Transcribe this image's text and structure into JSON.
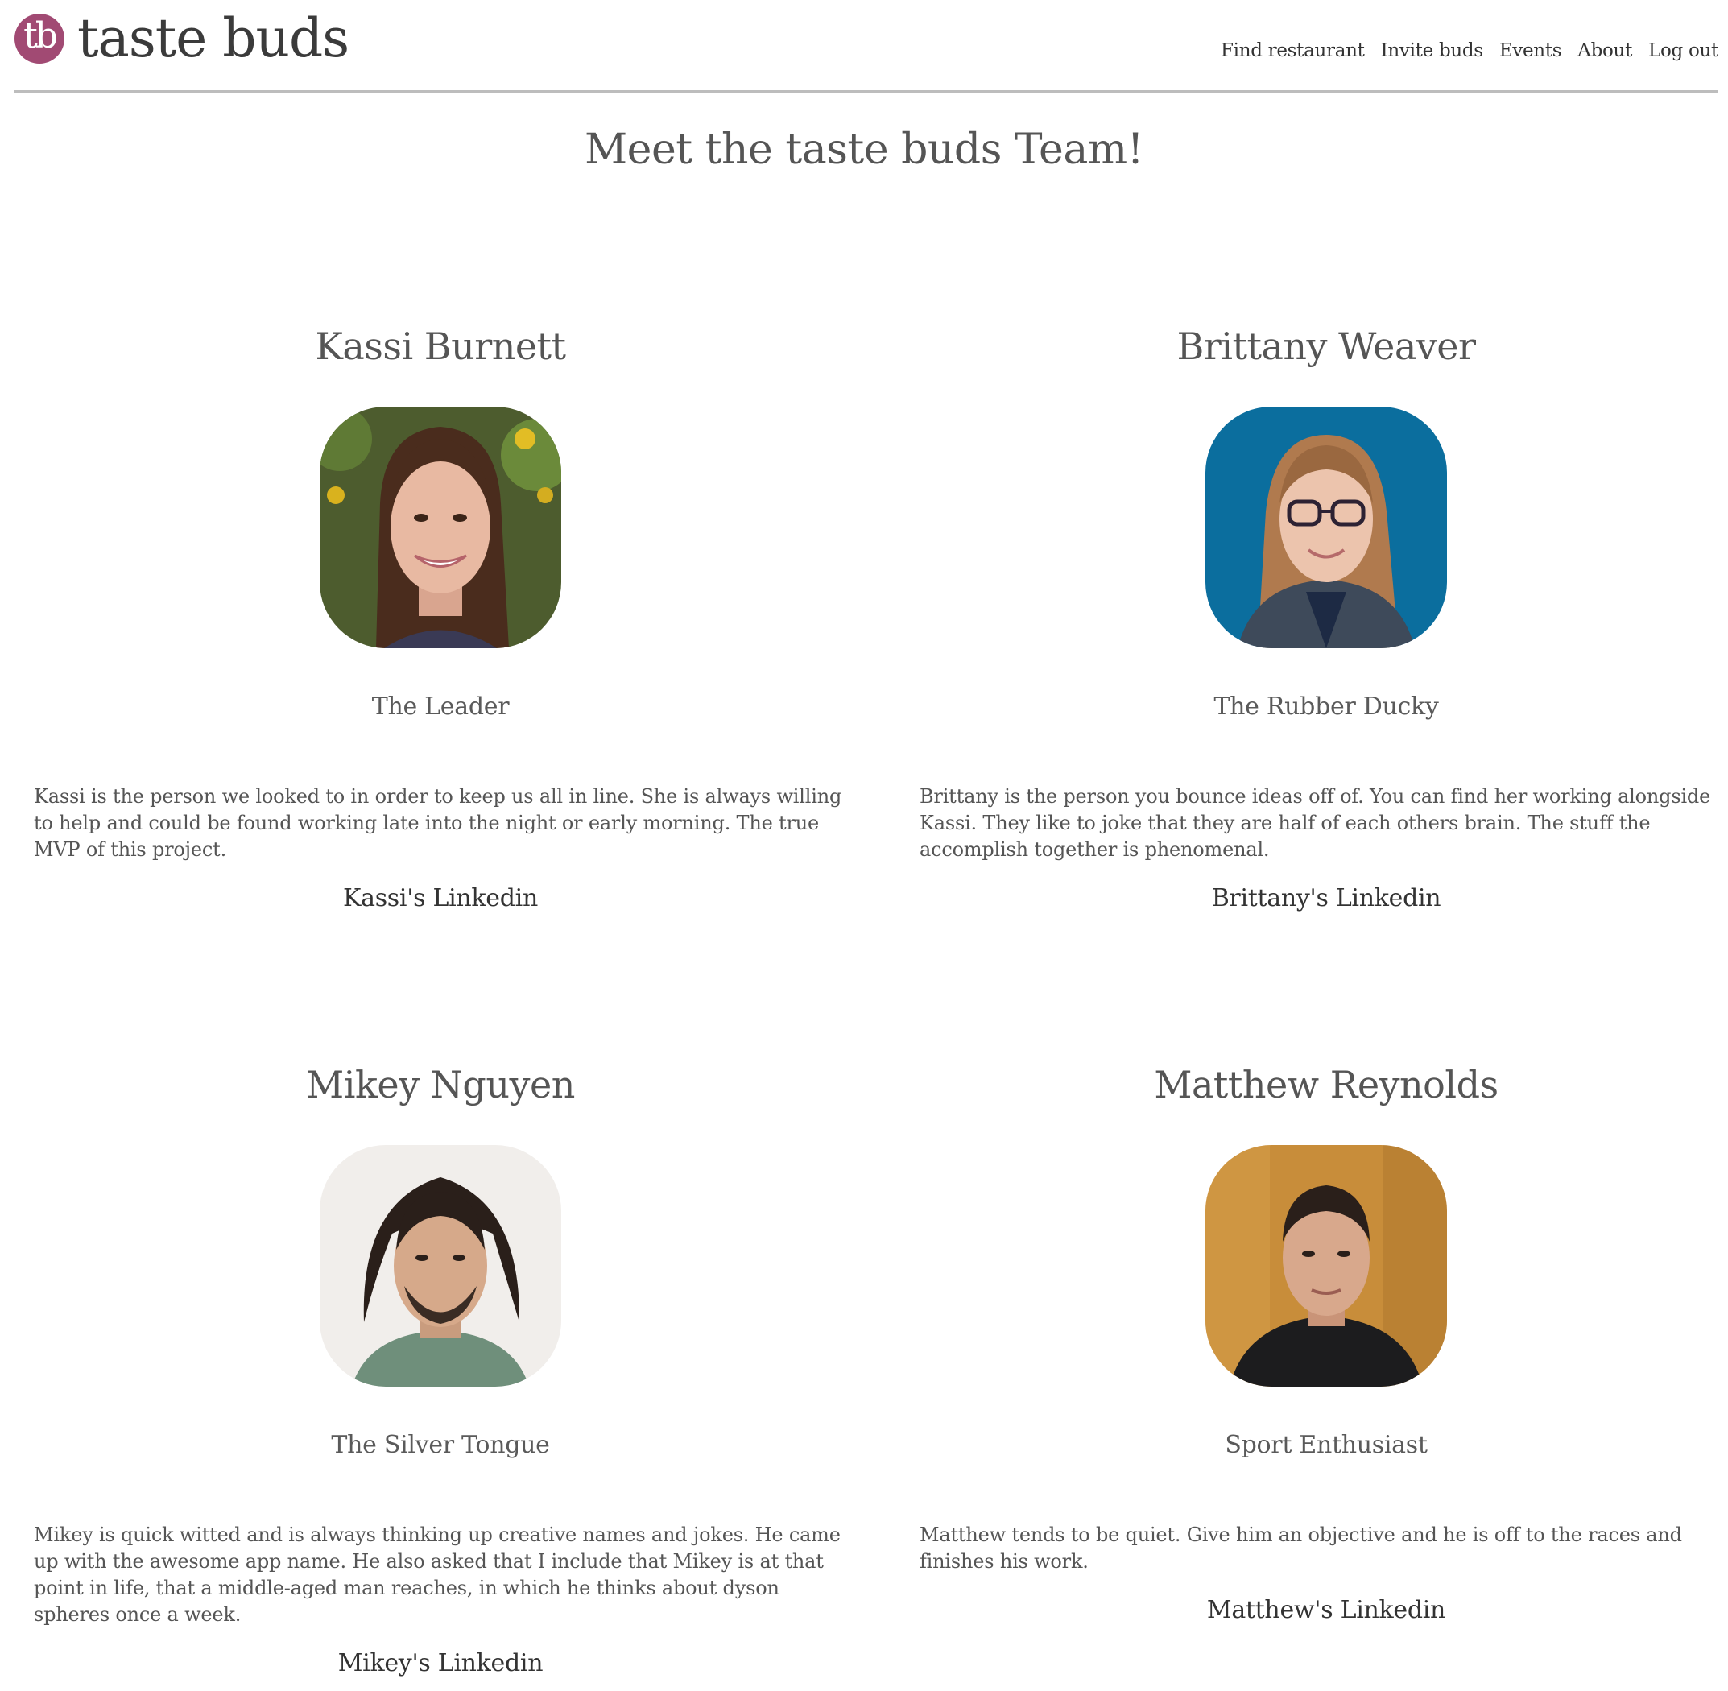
{
  "navbar": {
    "logo_text": "tb",
    "brand": "taste buds",
    "links": [
      "Find restaurant",
      "Invite buds",
      "Events",
      "About",
      "Log out"
    ]
  },
  "page": {
    "title": "Meet the taste buds Team!"
  },
  "members": [
    {
      "name": "Kassi Burnett",
      "role": "The Leader",
      "bio": "Kassi is the person we looked to in order to keep us all in line. She is always willing to help and could be found working late into the night or early morning. The true MVP of this project.",
      "link": "Kassi's Linkedin"
    },
    {
      "name": "Brittany Weaver",
      "role": "The Rubber Ducky",
      "bio": "Brittany is the person you bounce ideas off of. You can find her working alongside Kassi. They like to joke that they are half of each others brain. The stuff the accomplish together is phenomenal.",
      "link": "Brittany's Linkedin"
    },
    {
      "name": "Mikey Nguyen",
      "role": "The Silver Tongue",
      "bio": "Mikey is quick witted and is always thinking up creative names and jokes. He came up with the awesome app name. He also asked that I include that Mikey is at that point in life, that a middle-aged man reaches, in which he thinks about dyson spheres once a week.",
      "link": "Mikey's Linkedin"
    },
    {
      "name": "Matthew Reynolds",
      "role": "Sport Enthusiast",
      "bio": "Matthew tends to be quiet. Give him an objective and he is off to the races and finishes his work.",
      "link": "Matthew's Linkedin"
    }
  ]
}
